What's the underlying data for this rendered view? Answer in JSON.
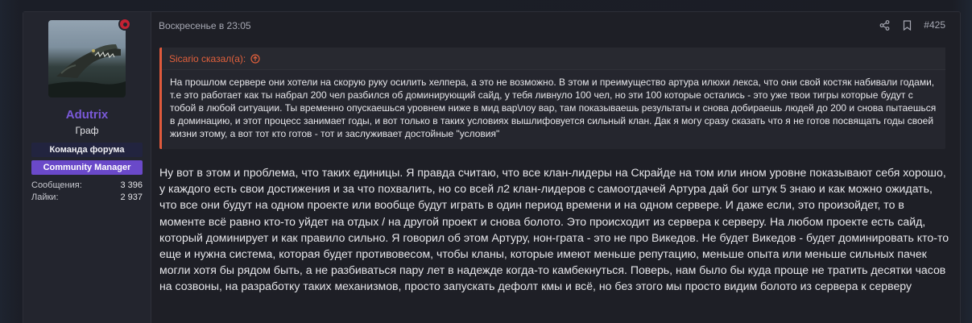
{
  "user": {
    "username": "Adutrix",
    "title": "Граф",
    "banners": [
      "Команда форума",
      "Community Manager"
    ],
    "stats": [
      {
        "label": "Сообщения:",
        "value": "3 396"
      },
      {
        "label": "Лайки:",
        "value": "2 937"
      }
    ],
    "colors": {
      "username": "#7a59d8",
      "online_dot": "#c42233",
      "cm_banner": "#6a49c9"
    }
  },
  "post": {
    "date": "Воскресенье в 23:05",
    "number": "#425",
    "icons": [
      "share-icon",
      "bookmark-icon"
    ],
    "quote": {
      "author": "Sicario сказал(а):",
      "text": "На прошлом сервере они хотели на скорую руку осилить хелпера, а это не возможно. В этом и преимущество артура илюхи лекса, что они свой костяк набивали годами, т.е это работает как ты набрал 200 чел разбился об доминирующий сайд, у тебя ливнуло 100 чел, но эти 100 которые остались - это уже твои тигры которые будут с тобой в любой ситуации. Ты временно опускаешься уровнем ниже в мид вар\\лоу вар, там показываешь результаты и снова добираешь людей до 200 и снова пытаешься в доминацию, и этот процесс занимает годы, и вот только в таких условиях вышлифовуется сильный клан. Дак я могу сразу сказать что я не готов посвящать годы своей жизни этому, а вот тот кто готов - тот и заслуживает достойные \"условия\"",
      "accent": "#e05a3c"
    },
    "body": "Ну вот в этом и проблема, что таких единицы. Я правда считаю, что все клан-лидеры на Скрайде на том или ином уровне показывают себя хорошо, у каждого есть свои достижения и за что похвалить, но со всей л2 клан-лидеров с самоотдачей Артура дай бог штук 5 знаю и как можно ожидать, что все они будут на одном проекте или вообще будут играть в один период времени и на одном сервере. И даже если, это произойдет, то в моменте всё равно кто-то уйдет на отдых / на другой проект и снова болото. Это происходит из сервера к серверу. На любом проекте есть сайд, который доминирует и как правило сильно. Я говорил об этом Артуру, нон-грата - это не про Викедов. Не будет Викедов - будет доминировать кто-то еще и нужна система, которая будет противовесом, чтобы кланы, которые имеют меньше репутацию, меньше опыта или меньше сильных пачек могли хотя бы рядом быть, а не разбиваться пару лет в надежде когда-то камбекнуться. Поверь, нам было бы куда проще не тратить десятки часов на созвоны, на разработку таких механизмов, просто запускать дефолт кмы и всё, но без этого мы просто видим болото из сервера к серверу"
  }
}
